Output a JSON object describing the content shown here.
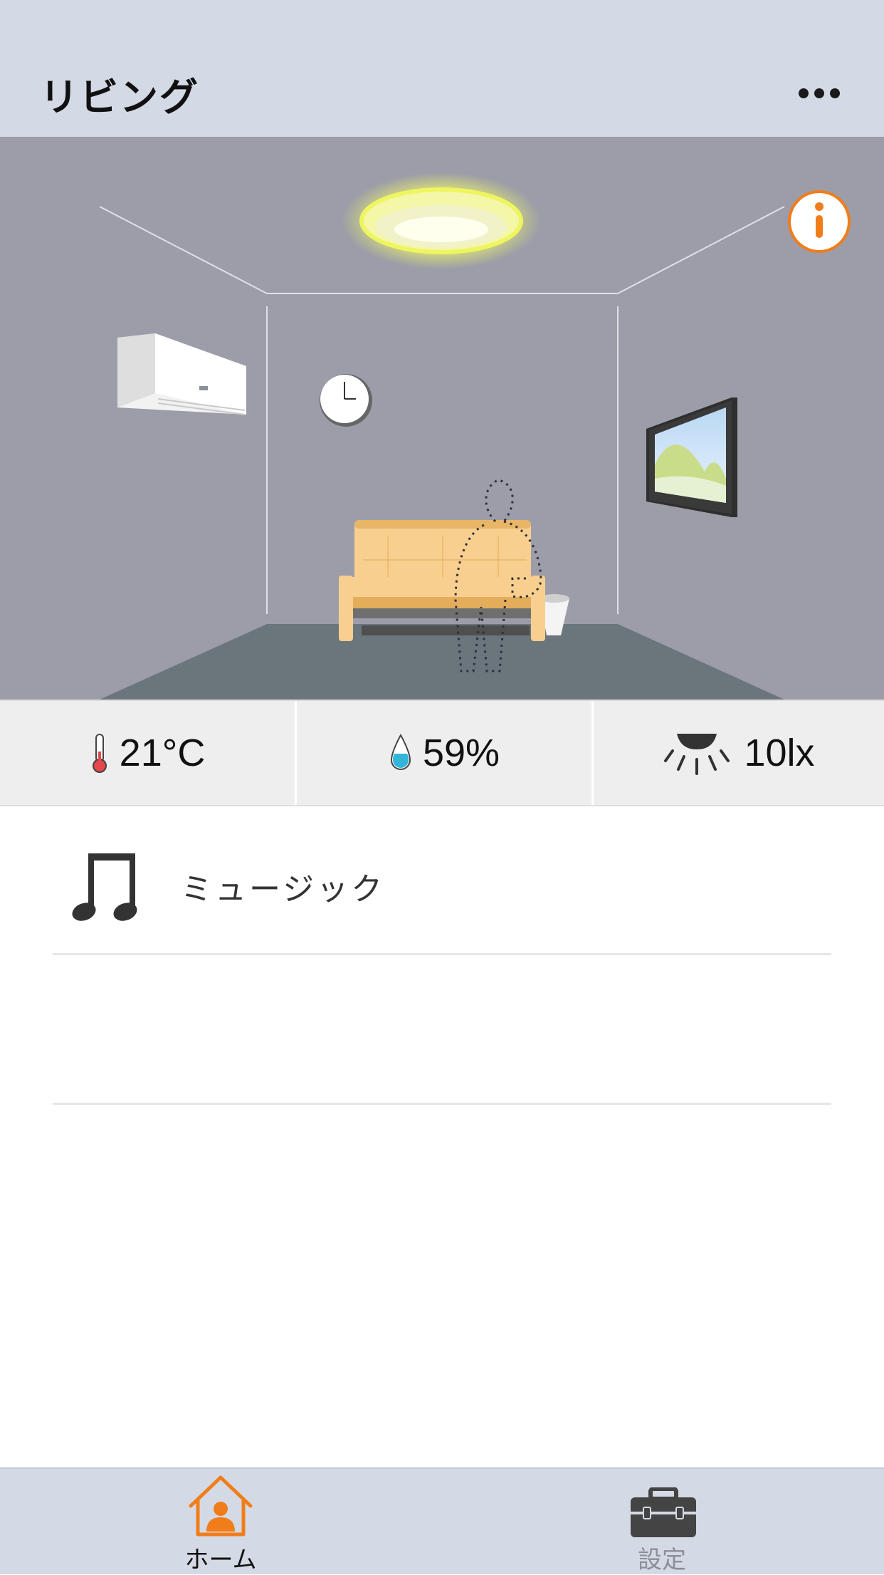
{
  "header": {
    "title": "リビング"
  },
  "stats": {
    "temperature": "21°C",
    "humidity": "59%",
    "illuminance": "10lx"
  },
  "list": {
    "music_label": "ミュージック"
  },
  "tabs": [
    {
      "label": "ホーム",
      "icon": "home-person-icon",
      "active": true
    },
    {
      "label": "設定",
      "icon": "toolbox-icon",
      "active": false
    }
  ],
  "colors": {
    "accent": "#f07d1a",
    "header_bg": "#d4dae5",
    "room_wall": "#9a9ba6",
    "room_floor": "#6b767d",
    "sofa": "#f9cf8f"
  }
}
